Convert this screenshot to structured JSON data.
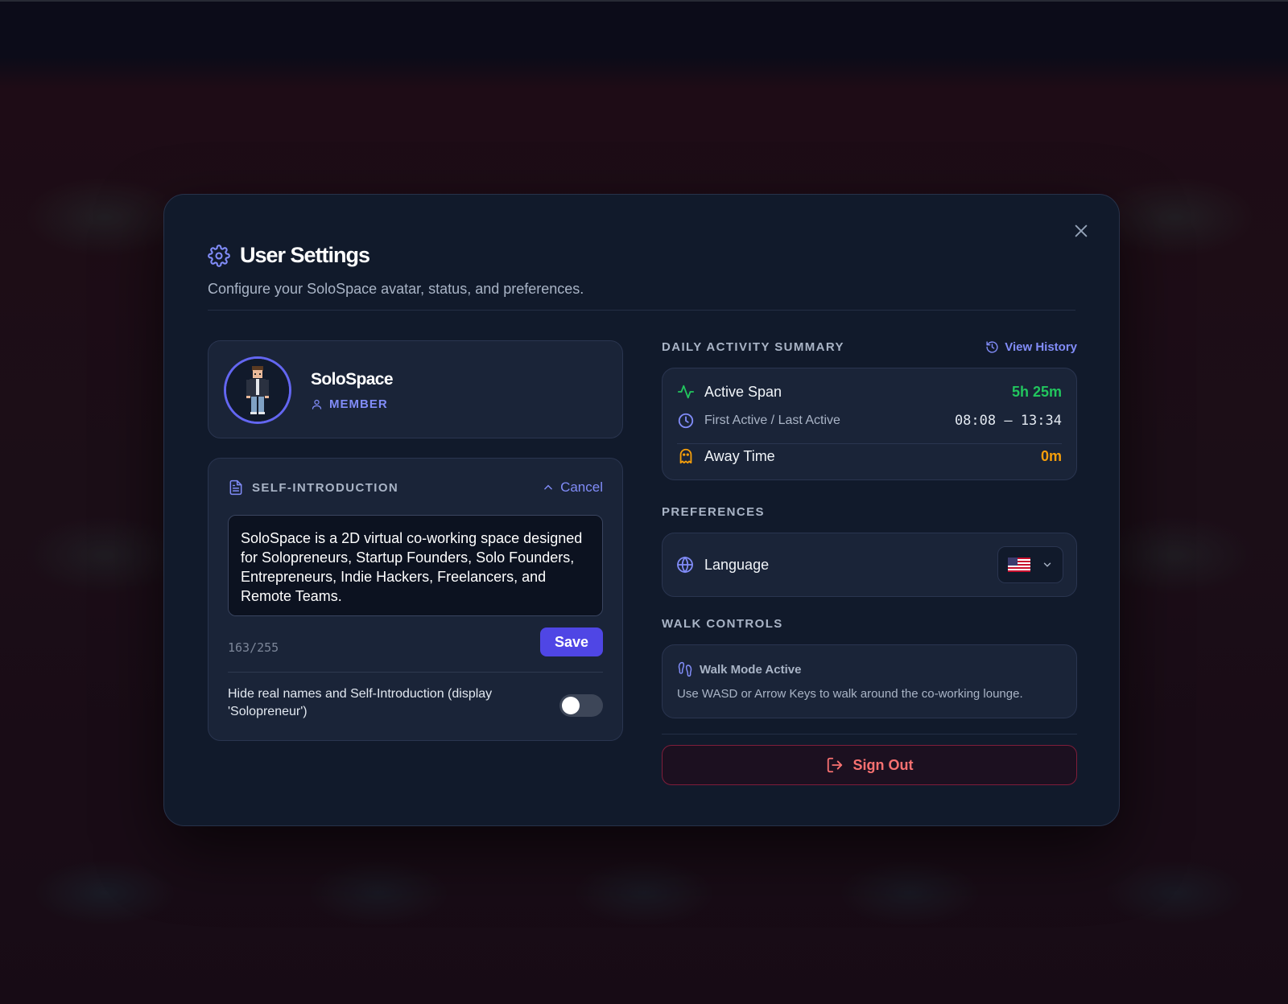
{
  "modal": {
    "title": "User Settings",
    "subtitle": "Configure your SoloSpace avatar, status, and preferences."
  },
  "profile": {
    "name": "SoloSpace",
    "role": "MEMBER"
  },
  "intro": {
    "label": "SELF-INTRODUCTION",
    "cancel_label": "Cancel",
    "text": "SoloSpace is a 2D virtual co-working space designed for Solopreneurs, Startup Founders, Solo Founders, Entrepreneurs, Indie Hackers, Freelancers, and Remote Teams.",
    "char_count": "163/255",
    "save_label": "Save",
    "hide_label": "Hide real names and Self-Introduction (display 'Solopreneur')",
    "hide_enabled": false
  },
  "summary": {
    "label": "DAILY ACTIVITY SUMMARY",
    "view_history_label": "View History",
    "active_span_label": "Active Span",
    "active_span_value": "5h 25m",
    "first_last_label": "First Active / Last Active",
    "first_last_value": "08:08 – 13:34",
    "away_label": "Away Time",
    "away_value": "0m"
  },
  "preferences": {
    "label": "PREFERENCES",
    "language_label": "Language",
    "language_selected": "en-US"
  },
  "walk": {
    "label": "WALK CONTROLS",
    "title": "Walk Mode Active",
    "description": "Use WASD or Arrow Keys to walk around the co-working lounge."
  },
  "signout": {
    "label": "Sign Out"
  },
  "colors": {
    "accent": "#6366f1",
    "success": "#22c55e",
    "warning": "#f59e0b",
    "danger": "#f87171"
  }
}
